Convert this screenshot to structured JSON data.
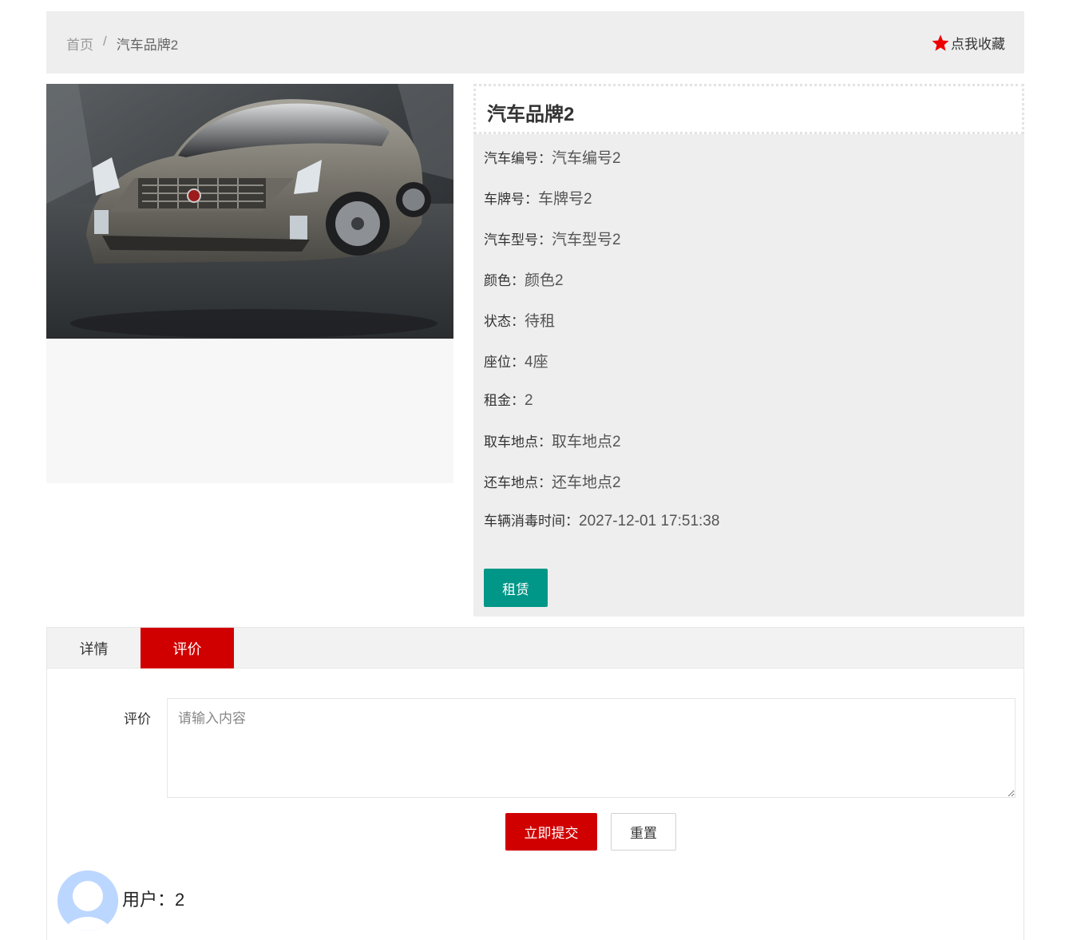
{
  "breadcrumb": {
    "home": "首页",
    "separator": "/",
    "current": "汽车品牌2"
  },
  "favorite": {
    "label": "点我收藏",
    "icon": "star-icon",
    "icon_color": "#ee0000"
  },
  "car": {
    "title": "汽车品牌2",
    "fields": [
      {
        "key": "汽车编号：",
        "value": "汽车编号2"
      },
      {
        "key": "车牌号：",
        "value": "车牌号2"
      },
      {
        "key": "汽车型号：",
        "value": "汽车型号2"
      },
      {
        "key": "颜色：",
        "value": "颜色2"
      },
      {
        "key": "状态：",
        "value": "待租"
      },
      {
        "key": "座位：",
        "value": "4座"
      },
      {
        "key": "租金：",
        "value": "2"
      },
      {
        "key": "取车地点：",
        "value": "取车地点2"
      },
      {
        "key": "还车地点：",
        "value": "还车地点2"
      },
      {
        "key": "车辆消毒时间：",
        "value": "2027-12-01 17:51:38"
      }
    ],
    "rent_label": "租赁"
  },
  "tabs": [
    {
      "label": "详情",
      "active": false
    },
    {
      "label": "评价",
      "active": true
    }
  ],
  "comment_form": {
    "label": "评价",
    "placeholder": "请输入内容",
    "value": "",
    "submit_label": "立即提交",
    "reset_label": "重置"
  },
  "reviews": [
    {
      "user": "用户：2"
    }
  ],
  "colors": {
    "accent_red": "#d10000",
    "teal": "#009688",
    "panel_gray": "#eeeeee"
  }
}
